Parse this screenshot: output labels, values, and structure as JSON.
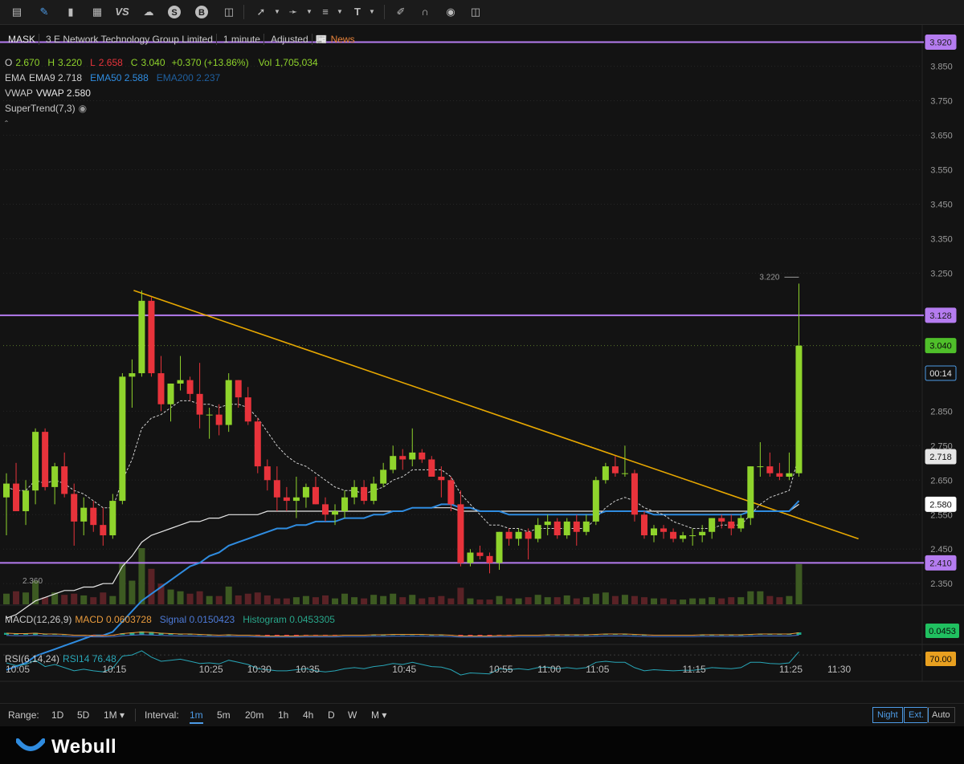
{
  "toolbar": {
    "icons": [
      "chart-type-icon",
      "pencil-icon",
      "candles-icon",
      "grid-icon",
      "vs-icon",
      "cloud-icon",
      "dollar-icon",
      "b-icon",
      "columns-icon",
      "trendline-icon",
      "line-tool-icon",
      "fib-icon",
      "text-tool-icon",
      "brush-icon",
      "magnet-icon",
      "eye-icon",
      "trash-icon"
    ],
    "vs_label": "VS",
    "dollar_label": "S",
    "b_label": "B"
  },
  "header": {
    "symbol": "MASK",
    "company": "3 E Network Technology Group Limited",
    "interval": "1 minute",
    "adjusted": "Adjusted",
    "news": "News"
  },
  "ohlc": {
    "o_label": "O",
    "o": "2.670",
    "h_label": "H",
    "h": "3.220",
    "l_label": "L",
    "l": "2.658",
    "c_label": "C",
    "c": "3.040",
    "change": "+0.370 (+13.86%)",
    "vol_label": "Vol",
    "vol": "1,705,034"
  },
  "ema": {
    "label": "EMA",
    "ema9": "EMA9 2.718",
    "ema50": "EMA50 2.588",
    "ema200": "EMA200 2.237"
  },
  "vwap": {
    "label": "VWAP",
    "value": "VWAP 2.580"
  },
  "supertrend": {
    "label": "SuperTrend(7,3)"
  },
  "macd": {
    "label": "MACD(12,26,9)",
    "macd": "MACD 0.0603728",
    "signal": "Signal 0.0150423",
    "histogram": "Histogram 0.0453305",
    "tag": "0.0453"
  },
  "rsi": {
    "label": "RSI(6,14,24)",
    "rsi14": "RSI14 76.48",
    "tag": "70.00"
  },
  "colors": {
    "up": "#8fd42c",
    "down": "#e8333b",
    "ema9": "#d0d0d0",
    "ema50": "#2f8ce0",
    "vwap": "#e6e6e6",
    "trend": "#e8a800",
    "level": "#b57cf0",
    "macd": "#4d7ad8",
    "signal": "#e89a3c",
    "rsi": "#28a6b7"
  },
  "chart_data": {
    "type": "candlestick",
    "title": "MASK 1 minute",
    "y_ticks": [
      "3.850",
      "3.750",
      "3.650",
      "3.550",
      "3.450",
      "3.350",
      "3.250",
      "2.850",
      "2.750",
      "2.650",
      "2.550",
      "2.450",
      "2.350"
    ],
    "x_ticks": [
      "10:05",
      "10:15",
      "10:25",
      "10:30",
      "10:35",
      "10:45",
      "10:55",
      "11:00",
      "11:05",
      "11:15",
      "11:25",
      "11:30"
    ],
    "ylim": [
      2.29,
      3.97
    ],
    "levels": [
      3.92,
      3.128,
      2.41
    ],
    "level_labels": [
      "3.920",
      "3.128",
      "2.410"
    ],
    "last_price_label": "3.040",
    "countdown": "00:14",
    "ema9_tag": "2.718",
    "vwap_tag": "2.580",
    "high_marker": "3.220",
    "low_marker": "2.360",
    "trendline": {
      "from": [
        "10:17",
        3.2
      ],
      "to": [
        "11:32",
        2.48
      ]
    },
    "candles": [
      {
        "o": 2.6,
        "h": 2.67,
        "l": 2.49,
        "c": 2.64
      },
      {
        "o": 2.64,
        "h": 2.7,
        "l": 2.56,
        "c": 2.56
      },
      {
        "o": 2.56,
        "h": 2.65,
        "l": 2.52,
        "c": 2.62
      },
      {
        "o": 2.62,
        "h": 2.8,
        "l": 2.58,
        "c": 2.79
      },
      {
        "o": 2.79,
        "h": 2.8,
        "l": 2.62,
        "c": 2.63
      },
      {
        "o": 2.63,
        "h": 2.7,
        "l": 2.58,
        "c": 2.69
      },
      {
        "o": 2.69,
        "h": 2.73,
        "l": 2.6,
        "c": 2.61
      },
      {
        "o": 2.61,
        "h": 2.64,
        "l": 2.46,
        "c": 2.53
      },
      {
        "o": 2.53,
        "h": 2.6,
        "l": 2.49,
        "c": 2.57
      },
      {
        "o": 2.57,
        "h": 2.59,
        "l": 2.5,
        "c": 2.52
      },
      {
        "o": 2.52,
        "h": 2.57,
        "l": 2.46,
        "c": 2.49
      },
      {
        "o": 2.49,
        "h": 2.61,
        "l": 2.48,
        "c": 2.59
      },
      {
        "o": 2.59,
        "h": 2.96,
        "l": 2.58,
        "c": 2.95
      },
      {
        "o": 2.95,
        "h": 3.0,
        "l": 2.86,
        "c": 2.96
      },
      {
        "o": 2.96,
        "h": 3.2,
        "l": 2.95,
        "c": 3.17
      },
      {
        "o": 3.17,
        "h": 3.18,
        "l": 2.95,
        "c": 2.96
      },
      {
        "o": 2.96,
        "h": 3.01,
        "l": 2.85,
        "c": 2.87
      },
      {
        "o": 2.87,
        "h": 2.93,
        "l": 2.82,
        "c": 2.93
      },
      {
        "o": 2.93,
        "h": 3.01,
        "l": 2.91,
        "c": 2.94
      },
      {
        "o": 2.94,
        "h": 2.95,
        "l": 2.88,
        "c": 2.9
      },
      {
        "o": 2.9,
        "h": 2.99,
        "l": 2.8,
        "c": 2.84
      },
      {
        "o": 2.84,
        "h": 2.86,
        "l": 2.77,
        "c": 2.84
      },
      {
        "o": 2.84,
        "h": 2.87,
        "l": 2.78,
        "c": 2.81
      },
      {
        "o": 2.81,
        "h": 2.96,
        "l": 2.79,
        "c": 2.94
      },
      {
        "o": 2.94,
        "h": 2.94,
        "l": 2.86,
        "c": 2.89
      },
      {
        "o": 2.89,
        "h": 2.92,
        "l": 2.81,
        "c": 2.82
      },
      {
        "o": 2.82,
        "h": 2.83,
        "l": 2.67,
        "c": 2.69
      },
      {
        "o": 2.69,
        "h": 2.71,
        "l": 2.62,
        "c": 2.65
      },
      {
        "o": 2.65,
        "h": 2.69,
        "l": 2.56,
        "c": 2.6
      },
      {
        "o": 2.6,
        "h": 2.63,
        "l": 2.56,
        "c": 2.59
      },
      {
        "o": 2.59,
        "h": 2.66,
        "l": 2.54,
        "c": 2.6
      },
      {
        "o": 2.6,
        "h": 2.64,
        "l": 2.57,
        "c": 2.63
      },
      {
        "o": 2.63,
        "h": 2.66,
        "l": 2.58,
        "c": 2.58
      },
      {
        "o": 2.58,
        "h": 2.6,
        "l": 2.53,
        "c": 2.55
      },
      {
        "o": 2.55,
        "h": 2.58,
        "l": 2.52,
        "c": 2.56
      },
      {
        "o": 2.56,
        "h": 2.62,
        "l": 2.54,
        "c": 2.6
      },
      {
        "o": 2.6,
        "h": 2.65,
        "l": 2.58,
        "c": 2.63
      },
      {
        "o": 2.63,
        "h": 2.65,
        "l": 2.58,
        "c": 2.59
      },
      {
        "o": 2.59,
        "h": 2.66,
        "l": 2.58,
        "c": 2.64
      },
      {
        "o": 2.64,
        "h": 2.7,
        "l": 2.63,
        "c": 2.68
      },
      {
        "o": 2.68,
        "h": 2.75,
        "l": 2.67,
        "c": 2.72
      },
      {
        "o": 2.72,
        "h": 2.74,
        "l": 2.68,
        "c": 2.71
      },
      {
        "o": 2.71,
        "h": 2.8,
        "l": 2.69,
        "c": 2.73
      },
      {
        "o": 2.73,
        "h": 2.74,
        "l": 2.7,
        "c": 2.71
      },
      {
        "o": 2.71,
        "h": 2.72,
        "l": 2.66,
        "c": 2.66
      },
      {
        "o": 2.66,
        "h": 2.69,
        "l": 2.6,
        "c": 2.65
      },
      {
        "o": 2.65,
        "h": 2.66,
        "l": 2.56,
        "c": 2.58
      },
      {
        "o": 2.58,
        "h": 2.62,
        "l": 2.4,
        "c": 2.41
      },
      {
        "o": 2.41,
        "h": 2.45,
        "l": 2.4,
        "c": 2.44
      },
      {
        "o": 2.44,
        "h": 2.46,
        "l": 2.42,
        "c": 2.43
      },
      {
        "o": 2.43,
        "h": 2.44,
        "l": 2.38,
        "c": 2.41
      },
      {
        "o": 2.41,
        "h": 2.5,
        "l": 2.39,
        "c": 2.5
      },
      {
        "o": 2.5,
        "h": 2.51,
        "l": 2.46,
        "c": 2.48
      },
      {
        "o": 2.48,
        "h": 2.51,
        "l": 2.46,
        "c": 2.5
      },
      {
        "o": 2.5,
        "h": 2.51,
        "l": 2.42,
        "c": 2.48
      },
      {
        "o": 2.48,
        "h": 2.54,
        "l": 2.47,
        "c": 2.52
      },
      {
        "o": 2.52,
        "h": 2.55,
        "l": 2.49,
        "c": 2.53
      },
      {
        "o": 2.53,
        "h": 2.54,
        "l": 2.48,
        "c": 2.49
      },
      {
        "o": 2.49,
        "h": 2.54,
        "l": 2.48,
        "c": 2.53
      },
      {
        "o": 2.53,
        "h": 2.55,
        "l": 2.46,
        "c": 2.5
      },
      {
        "o": 2.5,
        "h": 2.55,
        "l": 2.49,
        "c": 2.53
      },
      {
        "o": 2.53,
        "h": 2.66,
        "l": 2.52,
        "c": 2.65
      },
      {
        "o": 2.65,
        "h": 2.7,
        "l": 2.64,
        "c": 2.69
      },
      {
        "o": 2.69,
        "h": 2.72,
        "l": 2.66,
        "c": 2.67
      },
      {
        "o": 2.67,
        "h": 2.75,
        "l": 2.66,
        "c": 2.67
      },
      {
        "o": 2.67,
        "h": 2.68,
        "l": 2.53,
        "c": 2.55
      },
      {
        "o": 2.55,
        "h": 2.56,
        "l": 2.48,
        "c": 2.49
      },
      {
        "o": 2.49,
        "h": 2.52,
        "l": 2.47,
        "c": 2.51
      },
      {
        "o": 2.51,
        "h": 2.52,
        "l": 2.48,
        "c": 2.5
      },
      {
        "o": 2.5,
        "h": 2.51,
        "l": 2.47,
        "c": 2.48
      },
      {
        "o": 2.48,
        "h": 2.5,
        "l": 2.47,
        "c": 2.49
      },
      {
        "o": 2.49,
        "h": 2.51,
        "l": 2.46,
        "c": 2.49
      },
      {
        "o": 2.49,
        "h": 2.52,
        "l": 2.47,
        "c": 2.5
      },
      {
        "o": 2.5,
        "h": 2.54,
        "l": 2.48,
        "c": 2.54
      },
      {
        "o": 2.54,
        "h": 2.55,
        "l": 2.51,
        "c": 2.53
      },
      {
        "o": 2.53,
        "h": 2.55,
        "l": 2.49,
        "c": 2.51
      },
      {
        "o": 2.51,
        "h": 2.55,
        "l": 2.5,
        "c": 2.54
      },
      {
        "o": 2.54,
        "h": 2.69,
        "l": 2.52,
        "c": 2.69
      },
      {
        "o": 2.69,
        "h": 2.76,
        "l": 2.66,
        "c": 2.69
      },
      {
        "o": 2.69,
        "h": 2.73,
        "l": 2.66,
        "c": 2.67
      },
      {
        "o": 2.67,
        "h": 2.7,
        "l": 2.65,
        "c": 2.66
      },
      {
        "o": 2.66,
        "h": 2.73,
        "l": 2.65,
        "c": 2.67
      },
      {
        "o": 2.67,
        "h": 3.22,
        "l": 2.66,
        "c": 3.04
      }
    ],
    "volume": [
      18,
      22,
      20,
      40,
      12,
      20,
      16,
      18,
      15,
      12,
      20,
      14,
      70,
      40,
      95,
      60,
      35,
      25,
      22,
      18,
      22,
      14,
      14,
      30,
      15,
      18,
      20,
      15,
      10,
      10,
      12,
      14,
      12,
      15,
      10,
      18,
      12,
      10,
      16,
      14,
      18,
      12,
      16,
      10,
      12,
      14,
      10,
      28,
      10,
      8,
      8,
      14,
      10,
      10,
      12,
      16,
      12,
      12,
      15,
      10,
      12,
      18,
      20,
      14,
      16,
      14,
      12,
      10,
      10,
      8,
      8,
      10,
      10,
      12,
      10,
      12,
      12,
      22,
      22,
      14,
      12,
      14,
      68
    ],
    "ema9": [
      2.63,
      2.62,
      2.62,
      2.65,
      2.64,
      2.65,
      2.64,
      2.62,
      2.61,
      2.59,
      2.57,
      2.57,
      2.65,
      2.71,
      2.8,
      2.83,
      2.84,
      2.86,
      2.88,
      2.88,
      2.87,
      2.87,
      2.86,
      2.87,
      2.87,
      2.86,
      2.83,
      2.79,
      2.75,
      2.72,
      2.7,
      2.69,
      2.67,
      2.65,
      2.63,
      2.62,
      2.62,
      2.61,
      2.62,
      2.63,
      2.65,
      2.66,
      2.68,
      2.68,
      2.68,
      2.68,
      2.66,
      2.61,
      2.58,
      2.55,
      2.52,
      2.52,
      2.51,
      2.51,
      2.5,
      2.51,
      2.51,
      2.51,
      2.51,
      2.51,
      2.51,
      2.54,
      2.57,
      2.59,
      2.6,
      2.59,
      2.57,
      2.56,
      2.55,
      2.53,
      2.52,
      2.51,
      2.51,
      2.51,
      2.52,
      2.52,
      2.52,
      2.55,
      2.58,
      2.6,
      2.61,
      2.62,
      2.72
    ],
    "ema50": [
      2.1,
      2.11,
      2.12,
      2.14,
      2.15,
      2.16,
      2.17,
      2.18,
      2.19,
      2.2,
      2.2,
      2.21,
      2.24,
      2.27,
      2.3,
      2.32,
      2.34,
      2.36,
      2.38,
      2.4,
      2.41,
      2.43,
      2.44,
      2.46,
      2.47,
      2.48,
      2.49,
      2.5,
      2.51,
      2.51,
      2.52,
      2.52,
      2.53,
      2.53,
      2.53,
      2.54,
      2.54,
      2.54,
      2.55,
      2.55,
      2.56,
      2.56,
      2.57,
      2.57,
      2.57,
      2.58,
      2.58,
      2.57,
      2.57,
      2.56,
      2.56,
      2.56,
      2.55,
      2.55,
      2.55,
      2.55,
      2.55,
      2.55,
      2.55,
      2.55,
      2.55,
      2.55,
      2.56,
      2.56,
      2.56,
      2.56,
      2.56,
      2.55,
      2.55,
      2.55,
      2.55,
      2.55,
      2.55,
      2.55,
      2.55,
      2.55,
      2.55,
      2.56,
      2.56,
      2.56,
      2.56,
      2.56,
      2.59
    ],
    "vwap": [
      2.25,
      2.26,
      2.28,
      2.3,
      2.31,
      2.32,
      2.33,
      2.33,
      2.34,
      2.34,
      2.35,
      2.35,
      2.4,
      2.43,
      2.47,
      2.49,
      2.5,
      2.51,
      2.52,
      2.53,
      2.53,
      2.54,
      2.54,
      2.55,
      2.55,
      2.55,
      2.55,
      2.56,
      2.56,
      2.56,
      2.56,
      2.56,
      2.56,
      2.56,
      2.56,
      2.56,
      2.56,
      2.56,
      2.56,
      2.56,
      2.56,
      2.56,
      2.57,
      2.57,
      2.57,
      2.57,
      2.57,
      2.56,
      2.56,
      2.56,
      2.56,
      2.56,
      2.56,
      2.56,
      2.56,
      2.56,
      2.56,
      2.56,
      2.56,
      2.56,
      2.56,
      2.56,
      2.56,
      2.56,
      2.56,
      2.56,
      2.56,
      2.56,
      2.56,
      2.56,
      2.56,
      2.56,
      2.56,
      2.56,
      2.56,
      2.56,
      2.56,
      2.56,
      2.56,
      2.56,
      2.56,
      2.56,
      2.58
    ],
    "macd_hist": [
      0.04,
      0.03,
      0.03,
      0.04,
      0.02,
      0.02,
      0.01,
      -0.01,
      -0.01,
      -0.02,
      -0.02,
      -0.01,
      0.03,
      0.05,
      0.07,
      0.06,
      0.04,
      0.03,
      0.02,
      0.02,
      0.01,
      0.0,
      -0.01,
      0.0,
      -0.01,
      -0.01,
      -0.02,
      -0.03,
      -0.03,
      -0.03,
      -0.03,
      -0.02,
      -0.02,
      -0.02,
      -0.02,
      -0.01,
      -0.01,
      -0.01,
      0.0,
      0.0,
      0.01,
      0.01,
      0.01,
      0.01,
      0.0,
      0.0,
      -0.01,
      -0.03,
      -0.03,
      -0.03,
      -0.03,
      -0.02,
      -0.02,
      -0.01,
      -0.01,
      -0.01,
      0.0,
      0.0,
      0.0,
      0.0,
      0.0,
      0.01,
      0.02,
      0.02,
      0.02,
      0.01,
      0.0,
      -0.01,
      -0.01,
      -0.01,
      -0.01,
      -0.01,
      0.0,
      0.0,
      0.0,
      0.0,
      0.0,
      0.01,
      0.02,
      0.02,
      0.02,
      0.02,
      0.05
    ],
    "rsi14": [
      55,
      50,
      52,
      60,
      48,
      52,
      46,
      40,
      43,
      40,
      38,
      45,
      68,
      70,
      78,
      66,
      58,
      60,
      62,
      58,
      54,
      55,
      53,
      60,
      56,
      52,
      44,
      42,
      40,
      40,
      42,
      44,
      40,
      38,
      40,
      44,
      46,
      44,
      48,
      50,
      54,
      52,
      56,
      52,
      48,
      47,
      42,
      32,
      36,
      35,
      34,
      44,
      42,
      44,
      42,
      46,
      47,
      44,
      46,
      44,
      46,
      56,
      58,
      56,
      56,
      46,
      40,
      42,
      41,
      40,
      41,
      41,
      43,
      46,
      45,
      44,
      46,
      56,
      56,
      54,
      53,
      55,
      76
    ]
  },
  "x_axis": {
    "ticks": [
      "10:05",
      "10:15",
      "10:25",
      "10:30",
      "10:35",
      "10:45",
      "10:55",
      "11:00",
      "11:05",
      "11:15",
      "11:25",
      "11:30"
    ]
  },
  "range_bar": {
    "range_label": "Range:",
    "ranges": [
      "1D",
      "5D",
      "1M ▾"
    ],
    "interval_label": "Interval:",
    "intervals": [
      "1m",
      "5m",
      "20m",
      "1h",
      "4h",
      "D",
      "W",
      "M ▾"
    ],
    "night": "Night",
    "ext": "Ext.",
    "auto": "Auto"
  },
  "brand": {
    "name": "Webull"
  }
}
